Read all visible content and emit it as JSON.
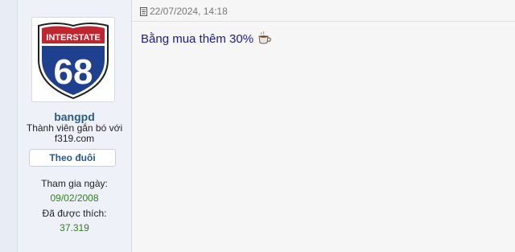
{
  "post": {
    "date": "22/07/2024, 14:18",
    "content": "Bằng mua thêm 30%",
    "emoji_icon": "coffee-cup-icon"
  },
  "user": {
    "avatar_text_top": "INTERSTATE",
    "avatar_number": "68",
    "username": "bangpd",
    "title": "Thành viên gắn bó với f319.com",
    "follow_label": "Theo đuôi",
    "joined_label": "Tham gia ngày:",
    "joined_value": "09/02/2008",
    "likes_label": "Đã được thích:",
    "likes_value": "37.319"
  },
  "colors": {
    "username": "#2b5a8e",
    "post_text": "#1b1b8a",
    "stat_value": "#2e7d20",
    "shield_blue": "#1f3f8f",
    "shield_red": "#c0262d"
  }
}
